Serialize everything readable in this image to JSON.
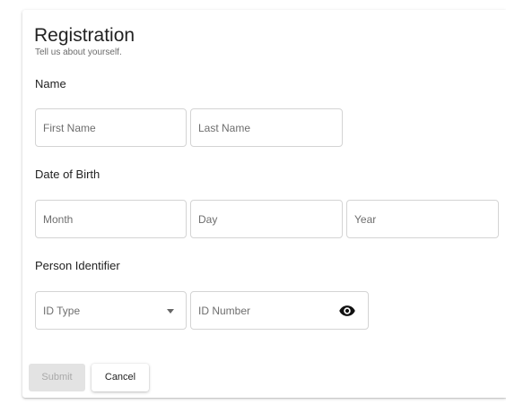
{
  "form": {
    "title": "Registration",
    "subtitle": "Tell us about yourself."
  },
  "sections": {
    "name": {
      "label": "Name",
      "first_name_placeholder": "First Name",
      "last_name_placeholder": "Last Name"
    },
    "dob": {
      "label": "Date of Birth",
      "month_placeholder": "Month",
      "day_placeholder": "Day",
      "year_placeholder": "Year"
    },
    "identifier": {
      "label": "Person Identifier",
      "id_type_placeholder": "ID Type",
      "id_number_placeholder": "ID Number",
      "id_type_icon": "chevron-down-icon",
      "id_number_icon": "eye-icon"
    }
  },
  "actions": {
    "submit_label": "Submit",
    "cancel_label": "Cancel",
    "submit_disabled": true
  }
}
